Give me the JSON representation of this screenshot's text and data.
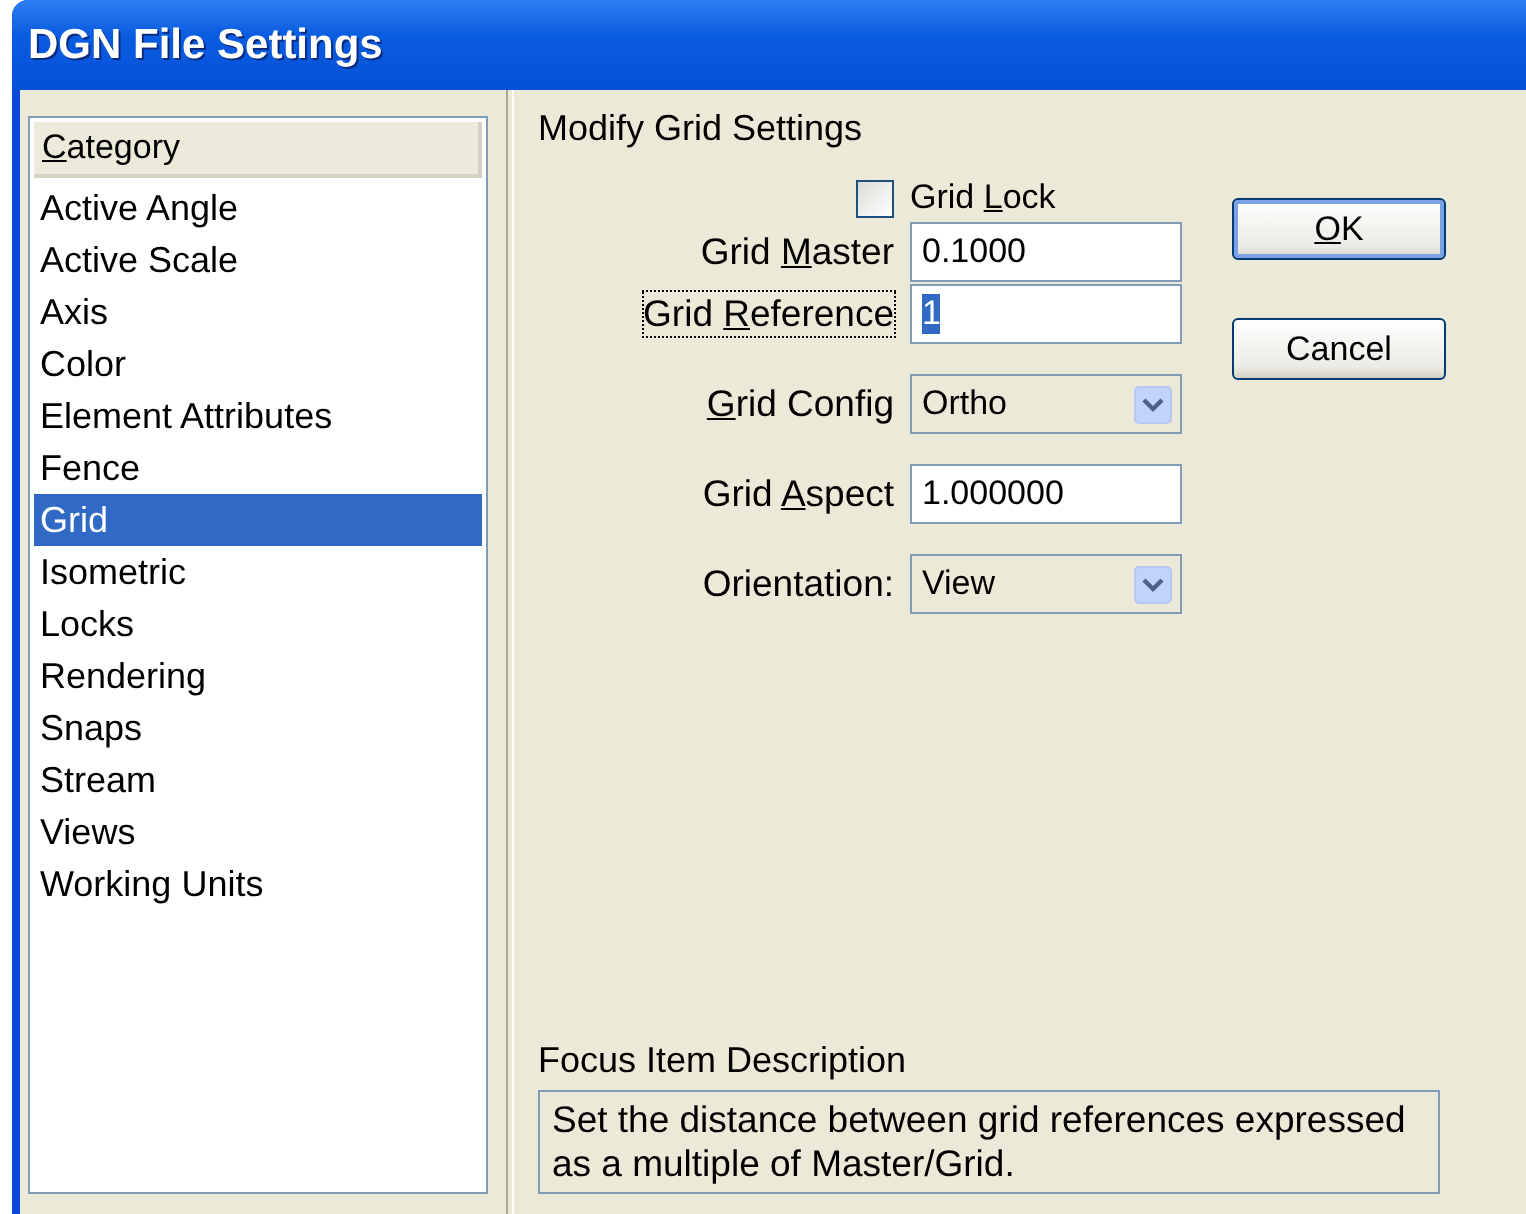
{
  "window": {
    "title": "DGN File Settings"
  },
  "category_list": {
    "header": {
      "key": "C",
      "after": "ategory"
    },
    "items": [
      {
        "label": "Active Angle",
        "selected": false
      },
      {
        "label": "Active Scale",
        "selected": false
      },
      {
        "label": "Axis",
        "selected": false
      },
      {
        "label": "Color",
        "selected": false
      },
      {
        "label": "Element Attributes",
        "selected": false
      },
      {
        "label": "Fence",
        "selected": false
      },
      {
        "label": "Grid",
        "selected": true
      },
      {
        "label": "Isometric",
        "selected": false
      },
      {
        "label": "Locks",
        "selected": false
      },
      {
        "label": "Rendering",
        "selected": false
      },
      {
        "label": "Snaps",
        "selected": false
      },
      {
        "label": "Stream",
        "selected": false
      },
      {
        "label": "Views",
        "selected": false
      },
      {
        "label": "Working Units",
        "selected": false
      }
    ]
  },
  "settings": {
    "title": "Modify Grid Settings",
    "fields": [
      {
        "kind": "checkbox",
        "label": {
          "before": "Grid ",
          "key": "L",
          "after": "ock"
        },
        "checked": false
      },
      {
        "kind": "text",
        "label": {
          "before": "Grid ",
          "key": "M",
          "after": "aster"
        },
        "value": "0.1000",
        "focused": false
      },
      {
        "kind": "text",
        "label": {
          "before": "Grid ",
          "key": "R",
          "after": "eference"
        },
        "value": "1",
        "focused": true
      },
      {
        "kind": "dropdown",
        "label": {
          "key": "G",
          "after": "rid Config"
        },
        "value": "Ortho"
      },
      {
        "kind": "text",
        "label": {
          "before": "Grid ",
          "key": "A",
          "after": "spect"
        },
        "value": "1.000000",
        "focused": false
      },
      {
        "kind": "dropdown",
        "label": {
          "before": "Orientation:"
        },
        "value": "View"
      }
    ]
  },
  "buttons": [
    {
      "label": {
        "key": "O",
        "after": "K"
      },
      "default": true
    },
    {
      "label": {
        "before": "Cancel"
      },
      "default": false
    }
  ],
  "focus_description": {
    "title": "Focus Item Description",
    "text": "Set the distance between grid references expressed as a multiple of Master/Grid."
  }
}
